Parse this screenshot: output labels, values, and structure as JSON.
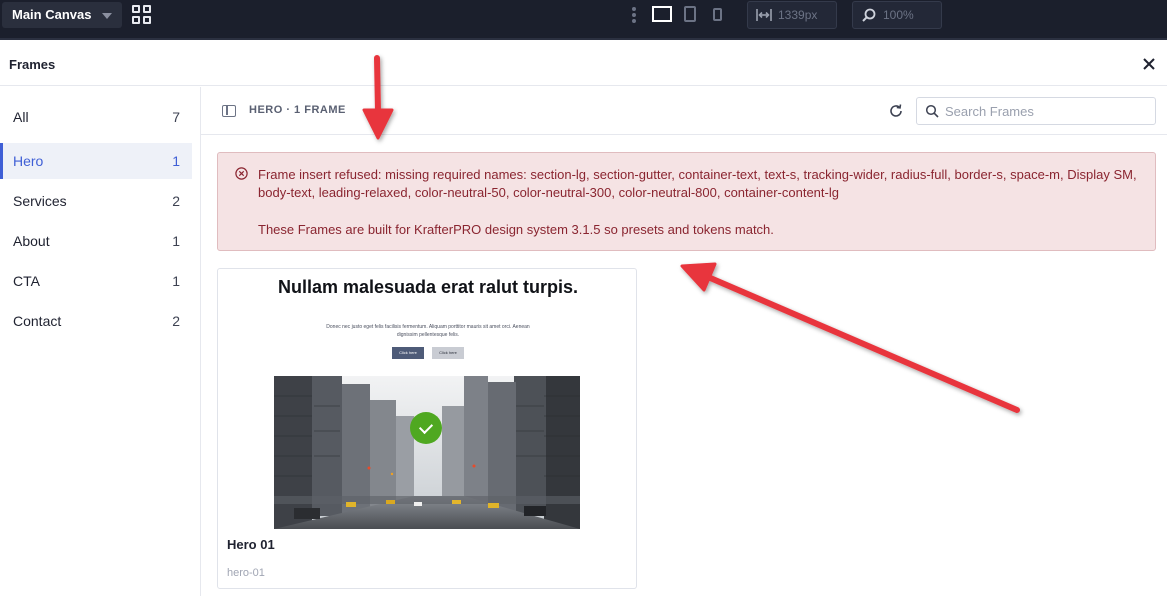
{
  "toolbar": {
    "canvas_select": "Main Canvas",
    "width_value": "1339px",
    "zoom_value": "100%",
    "icons": [
      "grid-icon",
      "more-vertical-icon",
      "desktop-icon",
      "tablet-icon",
      "mobile-icon",
      "width-arrows-icon",
      "zoom-icon"
    ]
  },
  "modal": {
    "title": "Frames",
    "close_icon": "close-icon"
  },
  "sidebar": {
    "categories": [
      {
        "label": "All",
        "count": "7"
      },
      {
        "label": "Hero",
        "count": "1",
        "active": true
      },
      {
        "label": "Services",
        "count": "2"
      },
      {
        "label": "About",
        "count": "1"
      },
      {
        "label": "CTA",
        "count": "1"
      },
      {
        "label": "Contact",
        "count": "2"
      }
    ]
  },
  "content": {
    "breadcrumb": "HERO · 1 FRAME",
    "search_placeholder": "Search Frames",
    "search_value": ""
  },
  "error": {
    "message": "Frame insert refused: missing required names: section-lg, section-gutter, container-text, text-s, tracking-wider, radius-full, border-s, space-m, Display SM, body-text, leading-relaxed, color-neutral-50, color-neutral-300, color-neutral-800, container-content-lg",
    "note": "These Frames are built for KrafterPRO design system 3.1.5 so presets and tokens match."
  },
  "frame_card": {
    "preview_title": "Nullam malesuada erat ralut turpis.",
    "preview_body": "Donec nec justo eget felis facilisis fermentum. Aliquam porttitor mauris sit amet orci. Aenean dignissim pellentesque felis.",
    "preview_button_primary": "Click here",
    "preview_button_secondary": "Click here",
    "name": "Hero 01",
    "slug": "hero-01",
    "selected": true
  },
  "colors": {
    "toolbar_bg": "#1b1f2c",
    "accent": "#3f5fd6",
    "error_bg": "#f5e3e4",
    "error_text": "#8a2530",
    "check_green": "#4fa821",
    "annotation_red": "#e8353c"
  }
}
